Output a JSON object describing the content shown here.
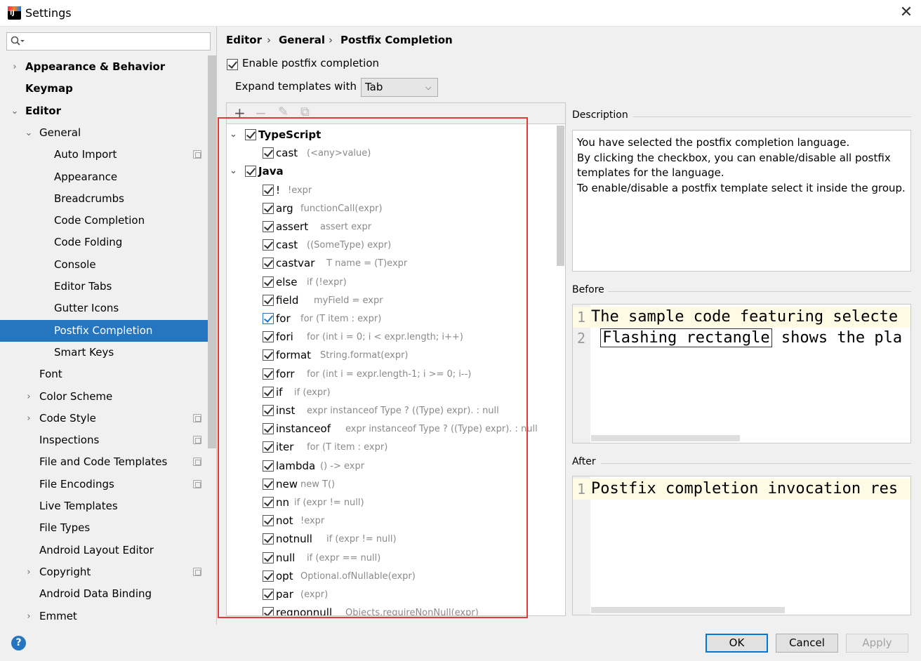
{
  "window": {
    "title": "Settings"
  },
  "search": {
    "placeholder": ""
  },
  "tree": [
    {
      "label": "Appearance & Behavior",
      "bold": true,
      "arrow": "›",
      "indent": 0,
      "copy": false
    },
    {
      "label": "Keymap",
      "bold": true,
      "arrow": "",
      "indent": 0,
      "copy": false
    },
    {
      "label": "Editor",
      "bold": true,
      "arrow": "⌄",
      "indent": 0,
      "copy": false
    },
    {
      "label": "General",
      "bold": false,
      "arrow": "⌄",
      "indent": 1,
      "copy": false
    },
    {
      "label": "Auto Import",
      "bold": false,
      "arrow": "",
      "indent": 2,
      "copy": true
    },
    {
      "label": "Appearance",
      "bold": false,
      "arrow": "",
      "indent": 2,
      "copy": false
    },
    {
      "label": "Breadcrumbs",
      "bold": false,
      "arrow": "",
      "indent": 2,
      "copy": false
    },
    {
      "label": "Code Completion",
      "bold": false,
      "arrow": "",
      "indent": 2,
      "copy": false
    },
    {
      "label": "Code Folding",
      "bold": false,
      "arrow": "",
      "indent": 2,
      "copy": false
    },
    {
      "label": "Console",
      "bold": false,
      "arrow": "",
      "indent": 2,
      "copy": false
    },
    {
      "label": "Editor Tabs",
      "bold": false,
      "arrow": "",
      "indent": 2,
      "copy": false
    },
    {
      "label": "Gutter Icons",
      "bold": false,
      "arrow": "",
      "indent": 2,
      "copy": false
    },
    {
      "label": "Postfix Completion",
      "bold": false,
      "arrow": "",
      "indent": 2,
      "copy": false,
      "selected": true
    },
    {
      "label": "Smart Keys",
      "bold": false,
      "arrow": "",
      "indent": 2,
      "copy": false
    },
    {
      "label": "Font",
      "bold": false,
      "arrow": "",
      "indent": 1,
      "copy": false
    },
    {
      "label": "Color Scheme",
      "bold": false,
      "arrow": "›",
      "indent": 1,
      "copy": false
    },
    {
      "label": "Code Style",
      "bold": false,
      "arrow": "›",
      "indent": 1,
      "copy": true
    },
    {
      "label": "Inspections",
      "bold": false,
      "arrow": "",
      "indent": 1,
      "copy": true
    },
    {
      "label": "File and Code Templates",
      "bold": false,
      "arrow": "",
      "indent": 1,
      "copy": true
    },
    {
      "label": "File Encodings",
      "bold": false,
      "arrow": "",
      "indent": 1,
      "copy": true
    },
    {
      "label": "Live Templates",
      "bold": false,
      "arrow": "",
      "indent": 1,
      "copy": false
    },
    {
      "label": "File Types",
      "bold": false,
      "arrow": "",
      "indent": 1,
      "copy": false
    },
    {
      "label": "Android Layout Editor",
      "bold": false,
      "arrow": "",
      "indent": 1,
      "copy": false
    },
    {
      "label": "Copyright",
      "bold": false,
      "arrow": "›",
      "indent": 1,
      "copy": true
    },
    {
      "label": "Android Data Binding",
      "bold": false,
      "arrow": "",
      "indent": 1,
      "copy": false
    },
    {
      "label": "Emmet",
      "bold": false,
      "arrow": "›",
      "indent": 1,
      "copy": false
    }
  ],
  "breadcrumb": [
    "Editor",
    "General",
    "Postfix Completion"
  ],
  "enable": {
    "label": "Enable postfix completion",
    "checked": true
  },
  "expand": {
    "label": "Expand templates with",
    "value": "Tab"
  },
  "toolbar": {
    "add": "+",
    "remove": "−",
    "edit": "✎",
    "copy": "⧉"
  },
  "groups": [
    {
      "name": "TypeScript",
      "items": [
        {
          "key": "cast",
          "example": "(<any>value)"
        }
      ]
    },
    {
      "name": "Java",
      "items": [
        {
          "key": "!",
          "example": "!expr"
        },
        {
          "key": "arg",
          "example": "functionCall(expr)"
        },
        {
          "key": "assert",
          "example": "assert expr"
        },
        {
          "key": "cast",
          "example": "((SomeType) expr)"
        },
        {
          "key": "castvar",
          "example": "T name = (T)expr"
        },
        {
          "key": "else",
          "example": "if (!expr)"
        },
        {
          "key": "field",
          "example": "myField = expr"
        },
        {
          "key": "for",
          "example": "for (T item : expr)",
          "focus": true
        },
        {
          "key": "fori",
          "example": "for (int i = 0; i < expr.length; i++)"
        },
        {
          "key": "format",
          "example": "String.format(expr)"
        },
        {
          "key": "forr",
          "example": "for (int i = expr.length-1; i >= 0; i--)"
        },
        {
          "key": "if",
          "example": "if (expr)"
        },
        {
          "key": "inst",
          "example": "expr instanceof Type ? ((Type) expr). : null"
        },
        {
          "key": "instanceof",
          "example": "expr instanceof Type ? ((Type) expr). : null"
        },
        {
          "key": "iter",
          "example": "for (T item : expr)"
        },
        {
          "key": "lambda",
          "example": "() -> expr"
        },
        {
          "key": "new",
          "example": "new T()"
        },
        {
          "key": "nn",
          "example": "if (expr != null)"
        },
        {
          "key": "not",
          "example": "!expr"
        },
        {
          "key": "notnull",
          "example": "if (expr != null)"
        },
        {
          "key": "null",
          "example": "if (expr == null)"
        },
        {
          "key": "opt",
          "example": "Optional.ofNullable(expr)"
        },
        {
          "key": "par",
          "example": "(expr)"
        },
        {
          "key": "reqnonnull",
          "example": "Objects.requireNonNull(expr)"
        }
      ]
    }
  ],
  "description": {
    "label": "Description",
    "lines": [
      "You have selected the postfix completion language.",
      "By clicking the checkbox, you can enable/disable all postfix templates for the language.",
      "To enable/disable a postfix template select it inside the group."
    ]
  },
  "before": {
    "label": "Before",
    "lines": [
      {
        "num": "1",
        "text": "The sample code featuring selecte"
      },
      {
        "num": "2",
        "pre": " ",
        "flash": "Flashing rectangle",
        "post": " shows the pla"
      }
    ]
  },
  "after": {
    "label": "After",
    "lines": [
      {
        "num": "1",
        "text": "Postfix completion invocation res"
      }
    ]
  },
  "buttons": {
    "help": "?",
    "ok": "OK",
    "cancel": "Cancel",
    "apply": "Apply"
  },
  "colors": {
    "accent": "#2675bf",
    "highlight_border": "#e53935"
  }
}
